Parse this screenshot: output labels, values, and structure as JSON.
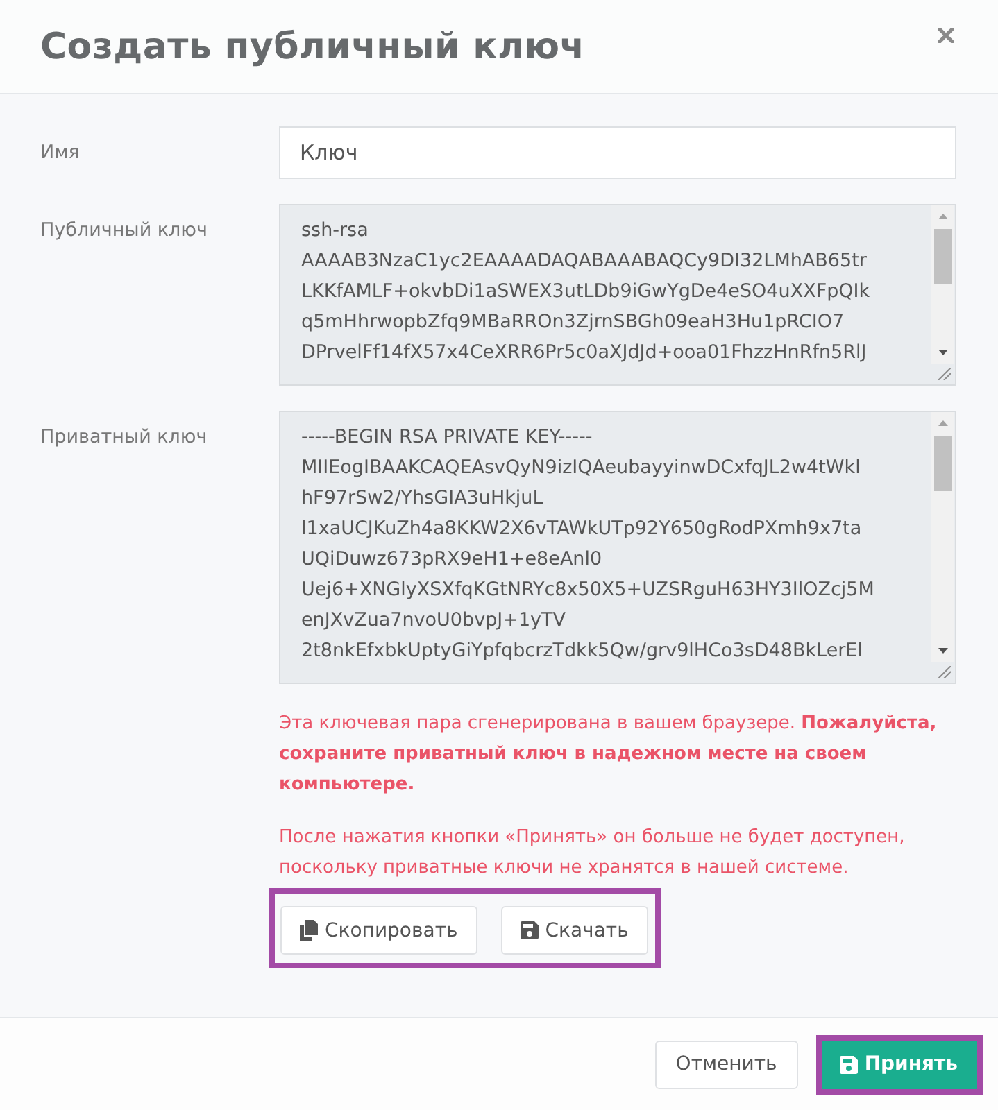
{
  "dialog": {
    "title": "Создать публичный ключ"
  },
  "fields": [
    {
      "kind": "input",
      "label": "Имя",
      "value": "Ключ"
    },
    {
      "kind": "textarea",
      "label": "Публичный ключ",
      "value": "ssh-rsa\nAAAAB3NzaC1yc2EAAAADAQABAAABAQCy9DI32LMhAB65tr\nLKKfAMLF+okvbDi1aSWEX3utLDb9iGwYgDe4eSO4uXXFpQIk\nq5mHhrwopbZfq9MBaRROn3ZjrnSBGh09eaH3Hu1pRCIO7\nDPrvelFf14fX57x4CeXRR6Pr5c0aXJdJd+ooa01FhzzHnRfn5RlJ"
    },
    {
      "kind": "textarea",
      "label": "Приватный ключ",
      "value": "-----BEGIN RSA PRIVATE KEY-----\nMIIEogIBAAKCAQEAsvQyN9izIQAeubayyinwDCxfqJL2w4tWkl\nhF97rSw2/YhsGIA3uHkjuL\nl1xaUCJKuZh4a8KKW2X6vTAWkUTp92Y650gRodPXmh9x7ta\nUQiDuwz673pRX9eH1+e8eAnl0\nUej6+XNGlyXSXfqKGtNRYc8x50X5+UZSRguH63HY3IlOZcj5M\nenJXvZua7nvoU0bvpJ+1yTV\n2t8nkEfxbkUptyGiYpfqbcrzTdkk5Qw/grv9lHCo3sD48BkLerEl"
    }
  ],
  "notice": [
    "Эта ключевая пара сгенерирована в вашем браузере. **Пожалуйста, сохраните приватный ключ в надежном месте на своем компьютере.**",
    "После нажатия кнопки «Принять» он больше не будет доступен, поскольку приватные ключи не хранятся в нашей системе."
  ],
  "key_actions": {
    "highlighted": true,
    "buttons": [
      {
        "kind": "copy",
        "label": "Скопировать"
      },
      {
        "kind": "download",
        "label": "Скачать"
      }
    ]
  },
  "footer_buttons": [
    {
      "kind": "secondary",
      "label": "Отменить",
      "highlighted": false
    },
    {
      "kind": "primary",
      "label": "Принять",
      "highlighted": true
    }
  ]
}
